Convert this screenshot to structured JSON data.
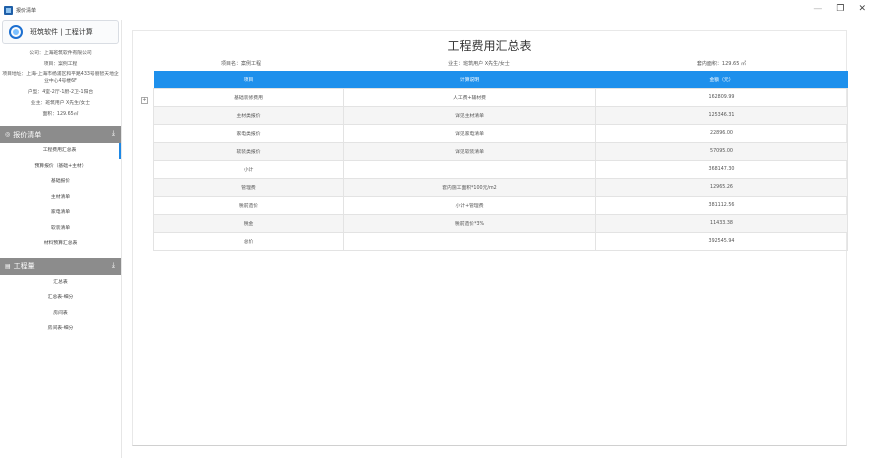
{
  "window": {
    "title": "报价清单",
    "minimize": "—",
    "restore": "❐",
    "close": "✕"
  },
  "brand": {
    "name": "班筑软件 | 工程计算"
  },
  "info": {
    "company": "公司：上海班筑软件有限公司",
    "project": "项目：案例工程",
    "address": "项目地址：上海-上海市杨浦区和平路433号丽智天地企业中心4号楼6F",
    "house_type": "户型：4室-2厅-1厨-2卫-1阳台",
    "owner": "业主：班筑用户 X先生/女士",
    "area": "面积：129.65㎡"
  },
  "sections": [
    {
      "title": "报价清单",
      "icon": "◎",
      "download": "⤓",
      "items": [
        "工程费用汇总表",
        "预算报价（基础+主材）",
        "基础报价",
        "主材清单",
        "家电清单",
        "软装清单",
        "材料预算汇总表"
      ]
    },
    {
      "title": "工程量",
      "icon": "▤",
      "download": "⤓",
      "items": [
        "汇总表",
        "汇总表-细分",
        "房间表",
        "房间表-细分"
      ]
    }
  ],
  "main": {
    "title": "工程费用汇总表",
    "project_name": "项目名：案例工程",
    "owner": "业主：班筑用户 X先生/女士",
    "inner_area": "套内面积：129.65 ㎡",
    "expand_symbol": "+",
    "columns": [
      "项目",
      "计算说明",
      "金额（元）"
    ],
    "rows": [
      [
        "基础装修费用",
        "人工费+辅材费",
        "162809.99"
      ],
      [
        "主材类报价",
        "详见主材清单",
        "125346.31"
      ],
      [
        "家电类报价",
        "详见家电清单",
        "22896.00"
      ],
      [
        "软装类报价",
        "详见软装清单",
        "57095.00"
      ],
      [
        "小计",
        "",
        "368147.30"
      ],
      [
        "管理费",
        "套内施工面积*100元/m2",
        "12965.26"
      ],
      [
        "税前造价",
        "小计+管理费",
        "381112.56"
      ],
      [
        "税金",
        "税前造价*3%",
        "11433.38"
      ],
      [
        "总价",
        "",
        "392545.94"
      ]
    ]
  }
}
